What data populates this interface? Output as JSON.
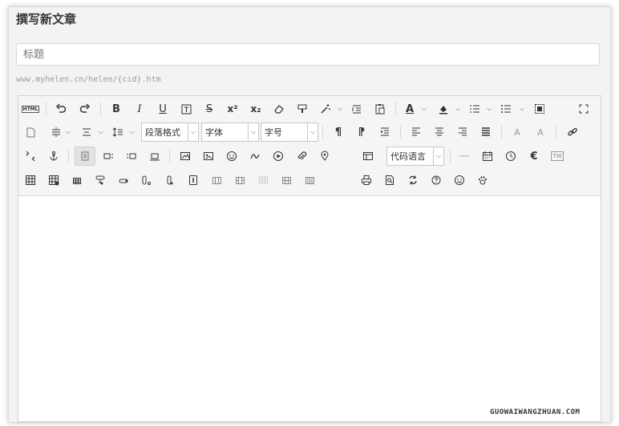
{
  "page": {
    "title": "撰写新文章"
  },
  "form": {
    "title_placeholder": "标题",
    "url_pattern": "www.myhelen.cn/helen/{cid}.htm"
  },
  "toolbar": {
    "row1": {
      "html": "HTML",
      "bold": "B",
      "italic": "I",
      "underline": "U",
      "strike": "S",
      "superscript": "x²",
      "subscript": "x₂",
      "font_color": "A"
    },
    "row2": {
      "paragraph_format": "段落格式",
      "font_family": "字体",
      "font_size": "字号",
      "ltr": "¶",
      "rtl": "¶",
      "font_up": "A",
      "font_down": "A"
    },
    "row3": {
      "code_language": "代码语言",
      "euro": "€",
      "tw": "TW"
    }
  },
  "watermark": "GUOWAIWANGZHUAN.COM"
}
